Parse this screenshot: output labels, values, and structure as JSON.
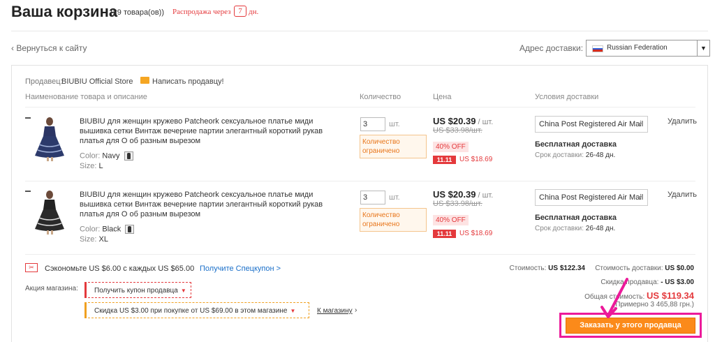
{
  "header": {
    "title": "Ваша корзина",
    "count": "(29 товара(ов))",
    "sale_prefix": "Распродажа через",
    "sale_days": "7",
    "sale_suffix": "дн."
  },
  "nav": {
    "back_label": "‹ Вернуться к сайту",
    "address_label": "Адрес доставки:",
    "address_value": "Russian Federation",
    "address_arrow": "▼"
  },
  "seller": {
    "label": "Продавец:",
    "name": "BIUBIU Official Store",
    "message_label": "Написать продавцу!"
  },
  "columns": {
    "product": "Наименование товара и описание",
    "quantity": "Количество",
    "price": "Цена",
    "shipping": "Условия доставки"
  },
  "items": [
    {
      "name": "BIUBIU для женщин кружево Patcheork сексуальное платье миди вышивка сетки Винтаж вечерние партии элегантный короткий рукав платья для О об разным вырезом",
      "color_label": "Color:",
      "color_value": "Navy",
      "size_label": "Size:",
      "size_value": "L",
      "qty": "3",
      "qty_unit": "шт.",
      "qty_limit": "Количество ограничено",
      "price": "US $20.39",
      "price_unit": " / шт.",
      "old_price": "US $33.98/шт.",
      "discount": "40% OFF",
      "promo_badge": "11.11",
      "promo_price": "US $18.69",
      "shipping_method": "China Post Registered Air Mail",
      "free_shipping": "Бесплатная доставка",
      "delivery_label": "Срок доставки:",
      "delivery_value": "26-48 дн.",
      "delete_label": "Удалить"
    },
    {
      "name": "BIUBIU для женщин кружево Patcheork сексуальное платье миди вышивка сетки Винтаж вечерние партии элегантный короткий рукав платья для О об разным вырезом",
      "color_label": "Color:",
      "color_value": "Black",
      "size_label": "Size:",
      "size_value": "XL",
      "qty": "3",
      "qty_unit": "шт.",
      "qty_limit": "Количество ограничено",
      "price": "US $20.39",
      "price_unit": " / шт.",
      "old_price": "US $33.98/шт.",
      "discount": "40% OFF",
      "promo_badge": "11.11",
      "promo_price": "US $18.69",
      "shipping_method": "China Post Registered Air Mail",
      "free_shipping": "Бесплатная доставка",
      "delivery_label": "Срок доставки:",
      "delivery_value": "26-48 дн.",
      "delete_label": "Удалить"
    }
  ],
  "promo": {
    "save_text": "Сэкономьте US $6.00 с каждых US $65.00",
    "save_link": "Получите Спецкупон >",
    "store_label": "Акция магазина:",
    "coupon_button": "Получить купон продавца",
    "discount_button": "Скидка US $3.00 при покупке от US $69.00 в этом магазине",
    "to_store": "К магазину",
    "to_store_arrow": "›"
  },
  "summary": {
    "cost_label": "Стоимость:",
    "cost_value": "US $122.34",
    "shipping_label": "Стоимость доставки:",
    "shipping_value": "US $0.00",
    "discount_label": "Скидка продавца:",
    "discount_value": "- US $3.00",
    "total_label": "Общая стоимость:",
    "total_value": "US $119.34",
    "approx": "(Примерно 3 465,88 грн.)",
    "order_button": "Заказать у этого продавца"
  },
  "colors": {
    "accent": "#fb8a1a",
    "sale_red": "#e4393c",
    "highlight": "#ec1a9a",
    "link": "#1a6fc9"
  }
}
